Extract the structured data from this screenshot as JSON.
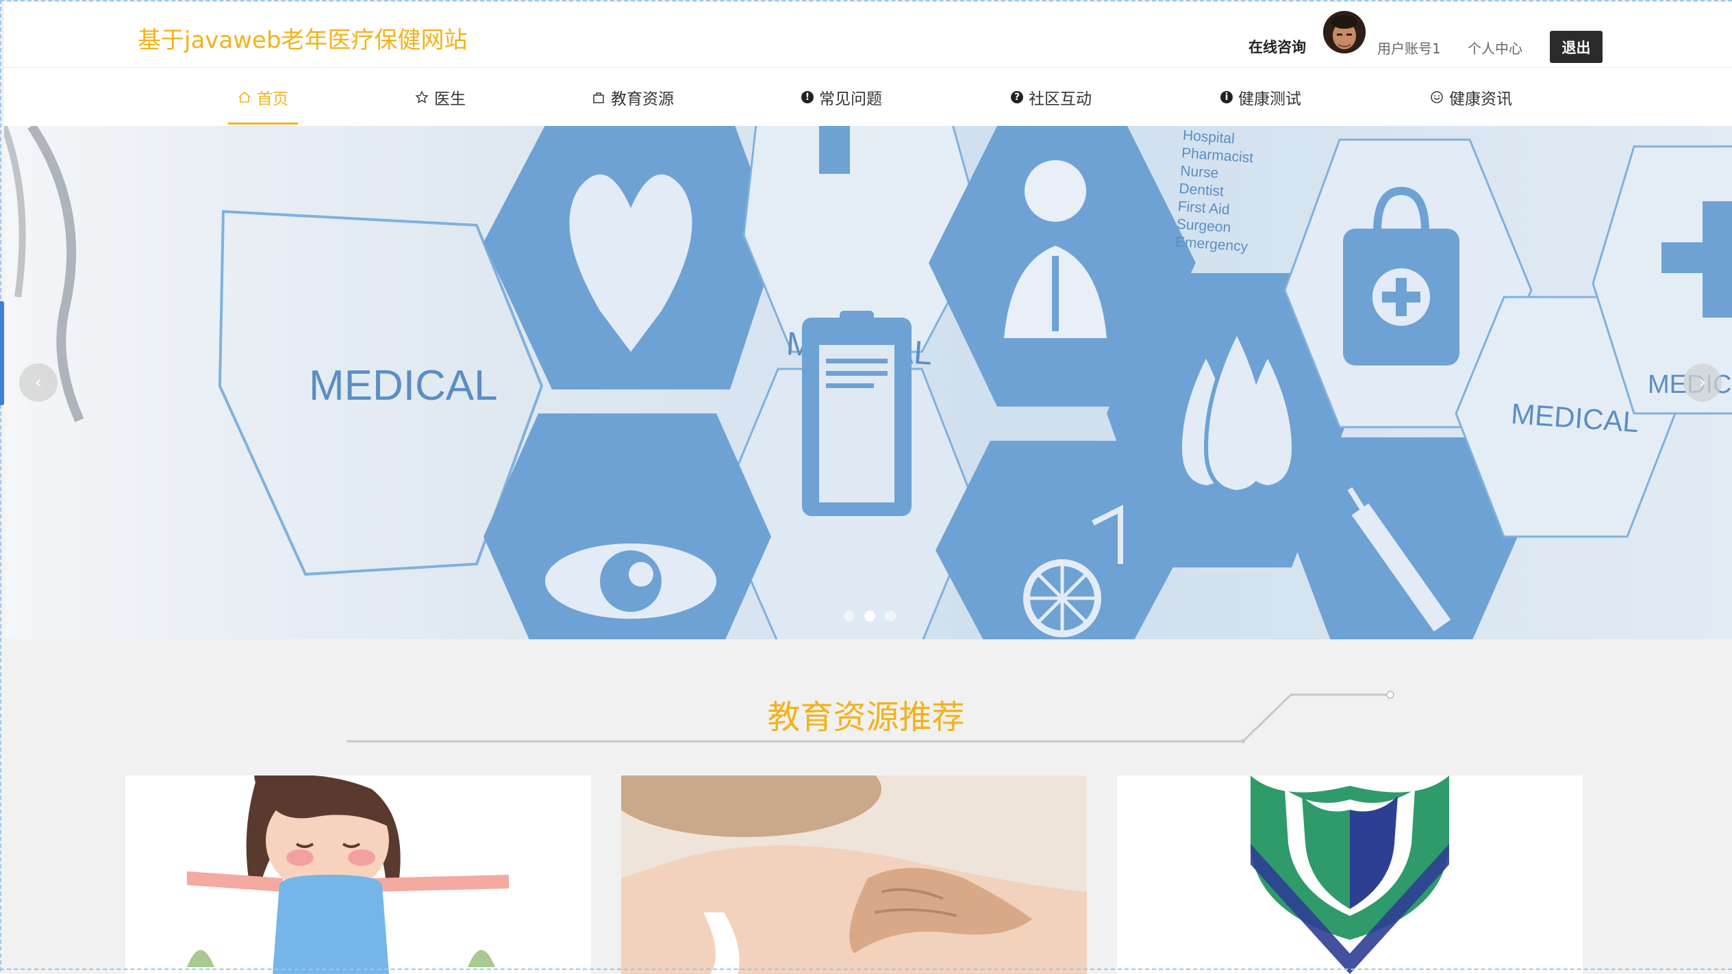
{
  "header": {
    "site_title": "基于javaweb老年医疗保健网站",
    "consult": "在线咨询",
    "username": "用户账号1",
    "user_center": "个人中心",
    "logout": "退出"
  },
  "nav": {
    "items": [
      {
        "label": "首页",
        "icon": "home-icon"
      },
      {
        "label": "医生",
        "icon": "star-icon"
      },
      {
        "label": "教育资源",
        "icon": "bag-icon"
      },
      {
        "label": "常见问题",
        "icon": "alert-circle-icon"
      },
      {
        "label": "社区互动",
        "icon": "question-circle-icon"
      },
      {
        "label": "健康测试",
        "icon": "info-circle-icon"
      },
      {
        "label": "健康资讯",
        "icon": "smile-icon"
      }
    ],
    "active_index": 0
  },
  "banner": {
    "hex_labels": [
      "MEDICAL",
      "MEDICAL",
      "MEDICAL",
      "MEDICAL"
    ],
    "list_labels": [
      "Hospital",
      "Pharmacist",
      "Nurse",
      "Dentist",
      "First Aid",
      "Surgeon",
      "Emergency"
    ],
    "slide_count": 3,
    "active_slide": 2
  },
  "section": {
    "title": "教育资源推荐"
  },
  "cards": [
    {
      "image": "yoga-girl-illustration"
    },
    {
      "image": "shoulder-massage-photo"
    },
    {
      "image": "green-blue-shield-logo"
    }
  ],
  "colors": {
    "accent": "#f2b31a",
    "medical_blue": "#6b9fd0",
    "page_bg": "#f1f1f1"
  }
}
